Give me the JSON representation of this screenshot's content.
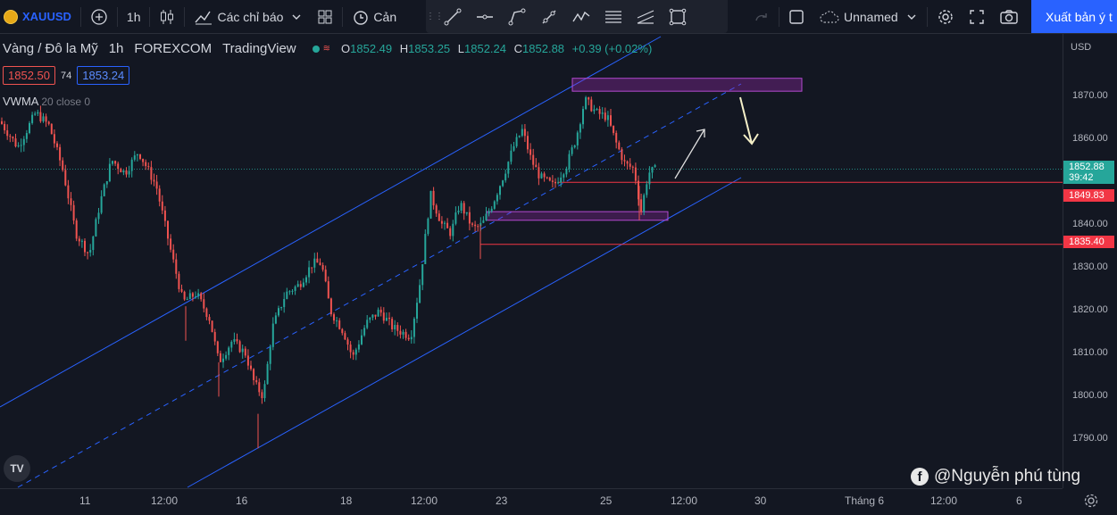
{
  "toolbar": {
    "symbol": "XAUUSD",
    "interval": "1h",
    "indicators_label": "Các chỉ báo",
    "alert_label": "Cản",
    "layout_name": "Unnamed",
    "export_label": "Xuất bản ý t"
  },
  "legend": {
    "title": "Vàng / Đô la Mỹ",
    "interval": "1h",
    "exchange": "FOREXCOM",
    "source": "TradingView",
    "o_label": "O",
    "o": "1852.49",
    "h_label": "H",
    "h": "1853.25",
    "l_label": "L",
    "l": "1852.24",
    "c_label": "C",
    "c": "1852.88",
    "change": "+0.39 (+0.02%)",
    "bid": "1852.50",
    "spread": "74",
    "ask": "1853.24",
    "indicator": "VWMA",
    "indicator_params": "20 close 0"
  },
  "price_scale": {
    "currency": "USD",
    "labels": [
      "1870.00",
      "1860.00",
      "1850.00",
      "1840.00",
      "1830.00",
      "1820.00",
      "1810.00",
      "1800.00",
      "1790.00"
    ],
    "current_price": "1852.88",
    "countdown": "39:42",
    "level_1": "1849.83",
    "level_2": "1835.40"
  },
  "time_scale": {
    "labels": [
      "11",
      "12:00",
      "16",
      "18",
      "12:00",
      "23",
      "25",
      "12:00",
      "30",
      "Tháng 6",
      "12:00",
      "6"
    ]
  },
  "watermark": {
    "text": "@Nguyễn phú tùng"
  },
  "colors": {
    "background": "#131722",
    "up": "#26a69a",
    "down": "#ef5350",
    "channel": "#2962ff",
    "zone": "#9c27b0",
    "accent": "#2962ff"
  },
  "chart_data": {
    "type": "candlestick",
    "symbol": "XAUUSD",
    "interval": "1h",
    "ylim": [
      1785,
      1880
    ],
    "last_price": 1852.88,
    "levels": [
      1849.83,
      1835.4
    ],
    "zones": [
      [
        1871,
        1874
      ],
      [
        1841,
        1843
      ]
    ],
    "path": [
      [
        0,
        1864
      ],
      [
        20,
        1858
      ],
      [
        40,
        1866
      ],
      [
        55,
        1863
      ],
      [
        70,
        1853
      ],
      [
        85,
        1838
      ],
      [
        100,
        1833
      ],
      [
        112,
        1845
      ],
      [
        125,
        1855
      ],
      [
        140,
        1852
      ],
      [
        155,
        1857
      ],
      [
        175,
        1849
      ],
      [
        190,
        1835
      ],
      [
        205,
        1822
      ],
      [
        220,
        1824
      ],
      [
        235,
        1818
      ],
      [
        245,
        1808
      ],
      [
        260,
        1813
      ],
      [
        275,
        1810
      ],
      [
        285,
        1803
      ],
      [
        295,
        1800
      ],
      [
        305,
        1816
      ],
      [
        320,
        1824
      ],
      [
        335,
        1826
      ],
      [
        350,
        1831
      ],
      [
        360,
        1831
      ],
      [
        370,
        1820
      ],
      [
        385,
        1815
      ],
      [
        395,
        1809
      ],
      [
        410,
        1817
      ],
      [
        425,
        1820
      ],
      [
        440,
        1816
      ],
      [
        460,
        1814
      ],
      [
        470,
        1826
      ],
      [
        482,
        1847
      ],
      [
        495,
        1840
      ],
      [
        505,
        1838
      ],
      [
        515,
        1845
      ],
      [
        530,
        1839
      ],
      [
        540,
        1840
      ],
      [
        552,
        1845
      ],
      [
        565,
        1852
      ],
      [
        575,
        1858
      ],
      [
        585,
        1862
      ],
      [
        595,
        1855
      ],
      [
        605,
        1851
      ],
      [
        620,
        1849
      ],
      [
        635,
        1854
      ],
      [
        645,
        1860
      ],
      [
        655,
        1869
      ],
      [
        668,
        1866
      ],
      [
        680,
        1865
      ],
      [
        690,
        1859
      ],
      [
        700,
        1854
      ],
      [
        710,
        1853
      ],
      [
        718,
        1843
      ],
      [
        726,
        1852
      ],
      [
        735,
        1852.9
      ]
    ]
  }
}
